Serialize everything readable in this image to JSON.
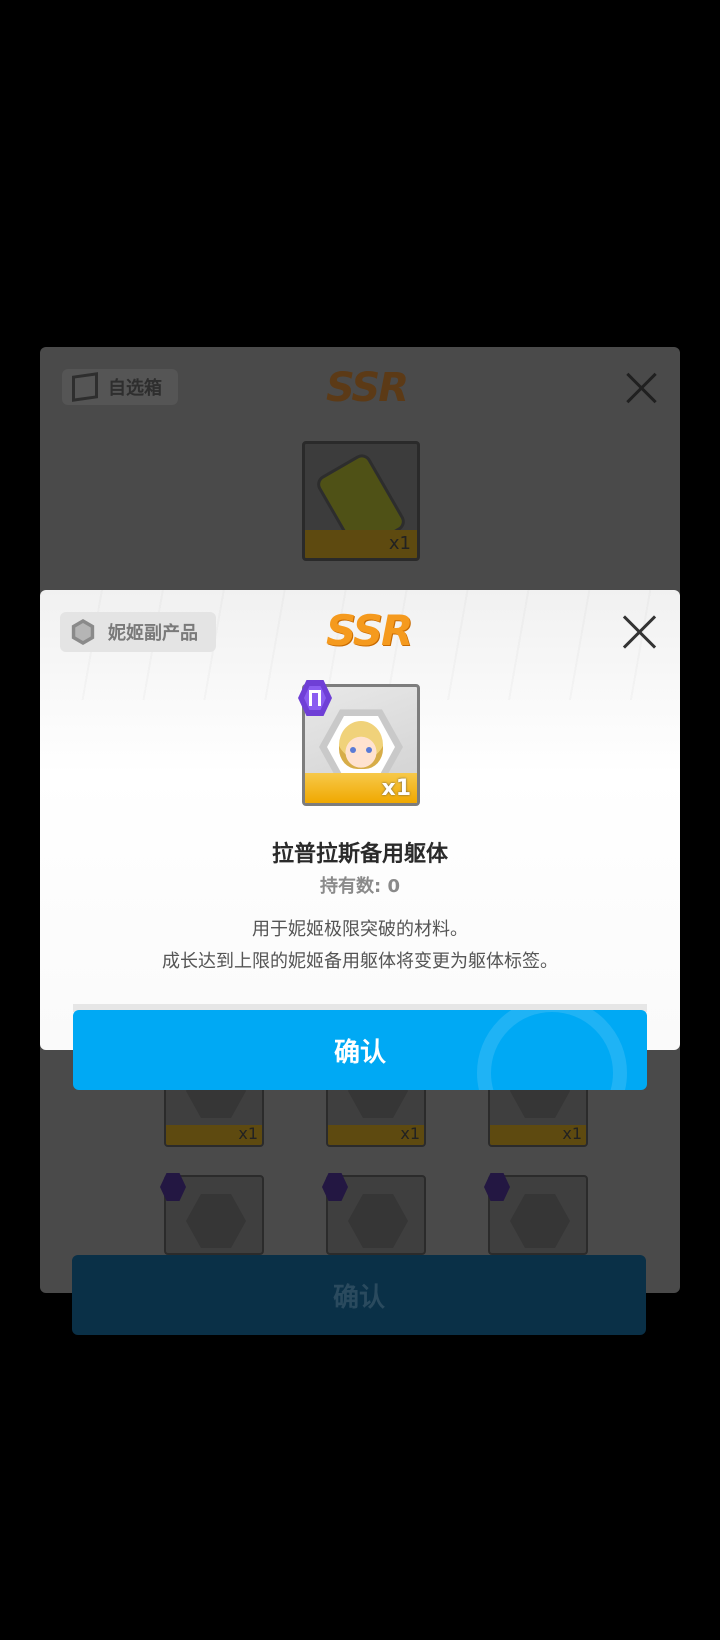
{
  "background_dialog": {
    "category_label": "自选箱",
    "rarity": "SSR",
    "item_quantity": "x1",
    "grid_row1": [
      {
        "qty": "x1"
      },
      {
        "qty": "x1"
      },
      {
        "qty": "x1"
      }
    ],
    "confirm_label": "确认"
  },
  "dialog": {
    "category_label": "妮姬副产品",
    "rarity": "SSR",
    "item_quantity": "x1",
    "item_name": "拉普拉斯备用躯体",
    "owned_text": "持有数: 0",
    "description_line1": "用于妮姬极限突破的材料。",
    "description_line2": "成长达到上限的妮姬备用躯体将变更为躯体标签。",
    "confirm_label": "确认"
  },
  "colors": {
    "accent": "#00a9f4",
    "rarity": "#f59a1e",
    "badge": "#6f3fd6"
  }
}
